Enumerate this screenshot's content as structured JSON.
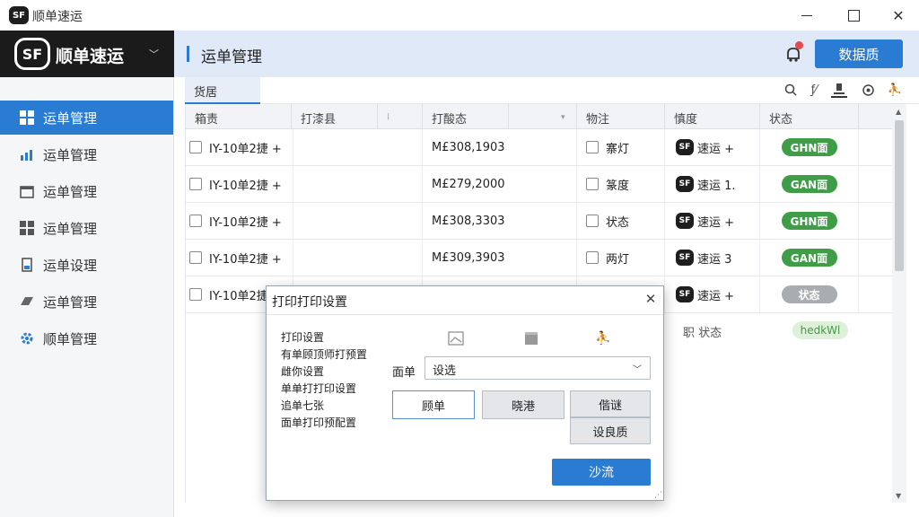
{
  "window": {
    "title": "顺单速运",
    "logo_text": "SF"
  },
  "sidebar": {
    "brand_name": "顺单速运",
    "brand_logo": "SF",
    "items": [
      {
        "label": "运单管理",
        "icon": "grid-icon",
        "active": true
      },
      {
        "label": "运单管理",
        "icon": "chart-icon",
        "active": false
      },
      {
        "label": "运单管理",
        "icon": "calendar-icon",
        "active": false
      },
      {
        "label": "运单管理",
        "icon": "grid-icon",
        "active": false
      },
      {
        "label": "运单设理",
        "icon": "document-icon",
        "active": false
      },
      {
        "label": "运单管理",
        "icon": "truck-icon",
        "active": false
      },
      {
        "label": "顺单管理",
        "icon": "gear-icon",
        "active": false
      }
    ]
  },
  "header": {
    "title": "运单管理",
    "primary_button": "数据质"
  },
  "tabs": [
    {
      "label": "货居"
    }
  ],
  "table": {
    "columns": [
      "箱责",
      "打漆县",
      "",
      "打酸态",
      "",
      "物注",
      "慎度",
      "状态"
    ],
    "rows": [
      {
        "c1": "IY-10单2捷 +",
        "c4": "M£308,1903",
        "c6": "寨灯",
        "c7": "速运 +",
        "status": "GHN面",
        "status_color": "#3f9d47"
      },
      {
        "c1": "IY-10单2捷 +",
        "c4": "M£279,2000",
        "c6": "篆度",
        "c7": "速运 1.",
        "status": "GAN面",
        "status_color": "#3f9d47"
      },
      {
        "c1": "IY-10单2捷 +",
        "c4": "M£308,3303",
        "c6": "状态",
        "c7": "速运 +",
        "status": "GHN面",
        "status_color": "#3f9d47"
      },
      {
        "c1": "IY-10单2捷 +",
        "c4": "M£309,3903",
        "c6": "两灯",
        "c7": "速运 3",
        "status": "GAN面",
        "status_color": "#3f9d47"
      },
      {
        "c1": "IY-10单2捷 +",
        "c4": "",
        "c6": "",
        "c7": "速运 +",
        "status": "状态",
        "status_color": "#a9acb0"
      }
    ],
    "partial_row": {
      "c6": "职 状态",
      "status": "hedkWl",
      "status_color": "#dff0d8"
    }
  },
  "dialog": {
    "title": "打印打印设置",
    "menu": [
      "打印设置",
      "有单顾顶师打预置",
      "雌你设置",
      "单单打打印设置",
      "追单七张",
      "面单打印预配置"
    ],
    "select_label": "面单",
    "select_value": "设选",
    "buttons": [
      "顾单",
      "晓港",
      "偕谜",
      "设良质"
    ],
    "ok": "沙流"
  }
}
